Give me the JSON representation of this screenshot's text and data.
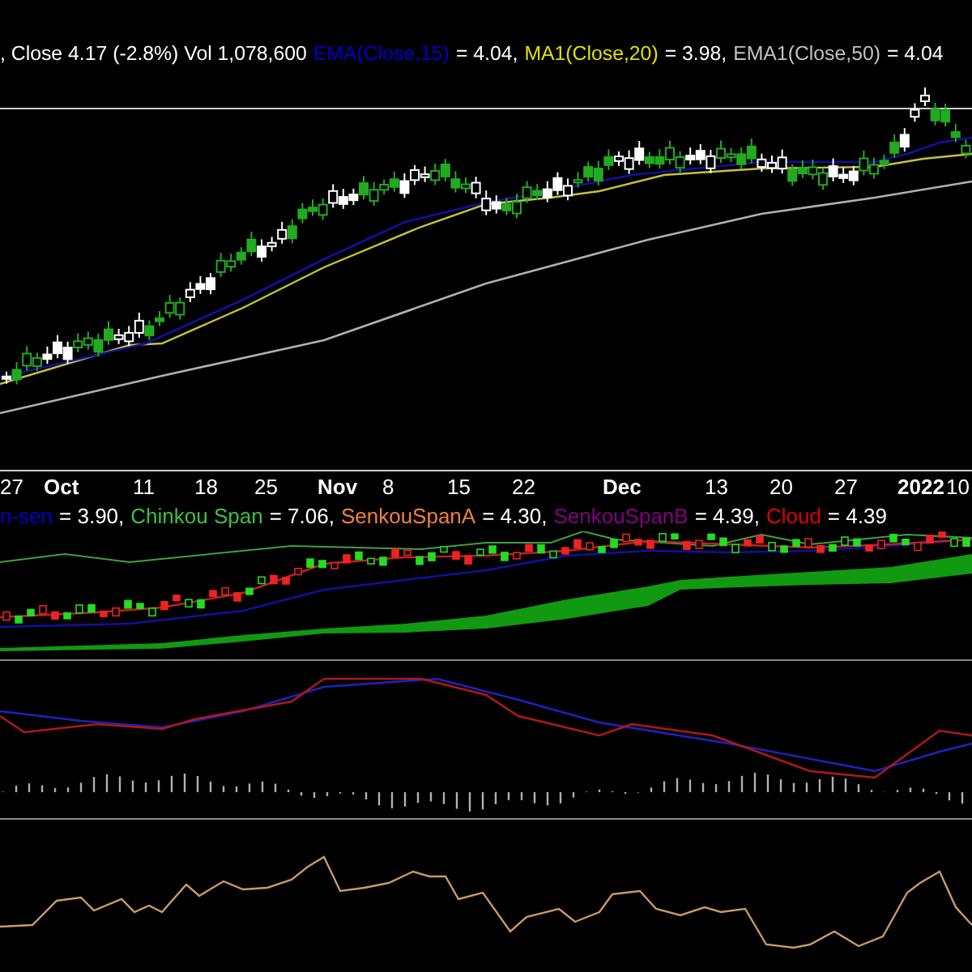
{
  "price_panel": {
    "legend": [
      {
        "text": ", Close 4.17 (-2.8%) Vol 1,078,600",
        "color": "#ffffff"
      },
      {
        "text": "EMA(Close,15)",
        "color": "#0000cc"
      },
      {
        "text": "= 4.04,",
        "color": "#ffffff"
      },
      {
        "text": "MA1(Close,20)",
        "color": "#e0e000"
      },
      {
        "text": "= 3.98,",
        "color": "#ffffff"
      },
      {
        "text": "EMA1(Close,50)",
        "color": "#c0c0c0"
      },
      {
        "text": "= 4.04",
        "color": "#ffffff"
      }
    ]
  },
  "date_axis": {
    "labels": [
      {
        "text": "27",
        "kind": "day"
      },
      {
        "text": "Oct",
        "kind": "month"
      },
      {
        "text": "11",
        "kind": "day"
      },
      {
        "text": "18",
        "kind": "day"
      },
      {
        "text": "25",
        "kind": "day"
      },
      {
        "text": "Nov",
        "kind": "month"
      },
      {
        "text": "8",
        "kind": "day"
      },
      {
        "text": "15",
        "kind": "day"
      },
      {
        "text": "22",
        "kind": "day"
      },
      {
        "text": "Dec",
        "kind": "month"
      },
      {
        "text": "13",
        "kind": "day"
      },
      {
        "text": "20",
        "kind": "day"
      },
      {
        "text": "27",
        "kind": "day"
      },
      {
        "text": "2022",
        "kind": "month"
      },
      {
        "text": "10",
        "kind": "day"
      }
    ]
  },
  "ichimoku_panel": {
    "legend": [
      {
        "text": "n-sen",
        "color": "#0000cc"
      },
      {
        "text": "= 3.90,",
        "color": "#ffffff"
      },
      {
        "text": "Chinkou Span",
        "color": "#40c040"
      },
      {
        "text": "= 7.06,",
        "color": "#ffffff"
      },
      {
        "text": "SenkouSpanA",
        "color": "#f08040"
      },
      {
        "text": "= 4.30,",
        "color": "#ffffff"
      },
      {
        "text": "SenkouSpanB",
        "color": "#800080"
      },
      {
        "text": "= 4.39,",
        "color": "#ffffff"
      },
      {
        "text": "Cloud",
        "color": "#e00000"
      },
      {
        "text": "= 4.39",
        "color": "#ffffff"
      }
    ]
  }
}
